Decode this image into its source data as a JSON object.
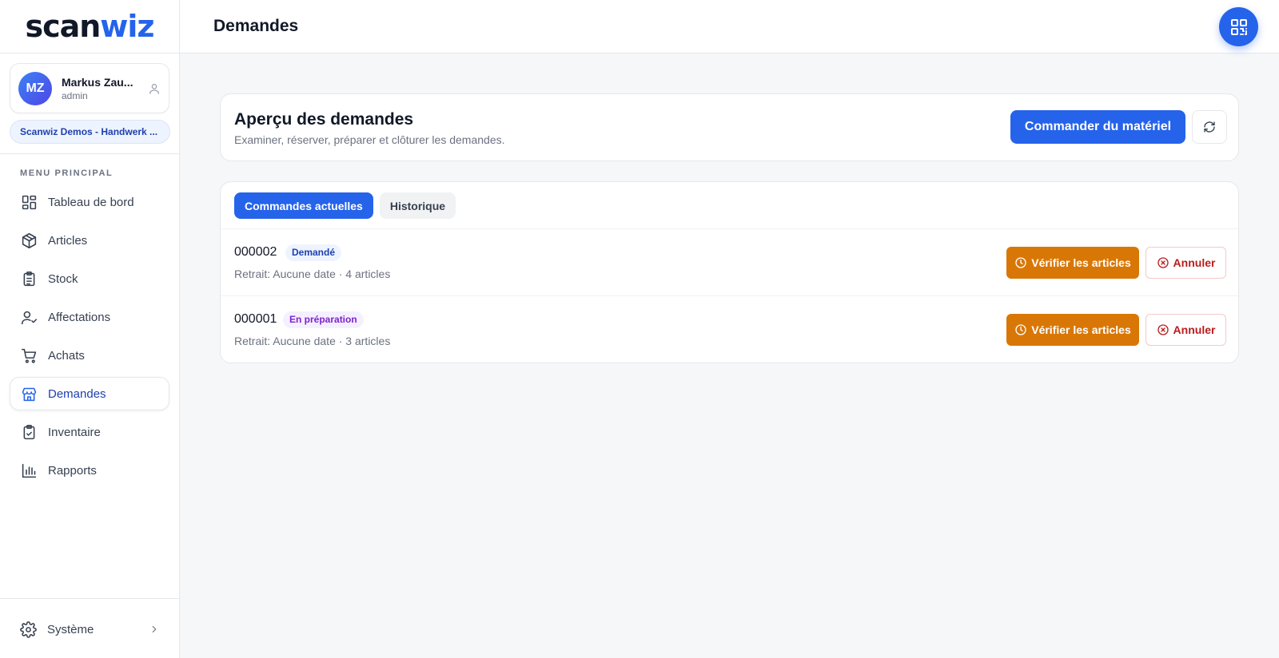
{
  "app": {
    "logo_part1": "scan",
    "logo_part2": "wiz",
    "accent_color": "#2563eb"
  },
  "user": {
    "initials": "MZ",
    "name": "Markus Zau...",
    "role": "admin",
    "company": "Scanwiz Demos - Handwerk ..."
  },
  "sidebar": {
    "heading": "MENU PRINCIPAL",
    "items": [
      {
        "label": "Tableau de bord",
        "icon": "dashboard-icon"
      },
      {
        "label": "Articles",
        "icon": "box-icon"
      },
      {
        "label": "Stock",
        "icon": "clipboard-list-icon"
      },
      {
        "label": "Affectations",
        "icon": "user-check-icon"
      },
      {
        "label": "Achats",
        "icon": "cart-icon"
      },
      {
        "label": "Demandes",
        "icon": "store-icon",
        "active": true
      },
      {
        "label": "Inventaire",
        "icon": "clipboard-check-icon"
      },
      {
        "label": "Rapports",
        "icon": "bar-chart-icon"
      }
    ],
    "system_label": "Système"
  },
  "header": {
    "title": "Demandes",
    "qr_icon": "qr-code-icon"
  },
  "overview": {
    "title": "Aperçu des demandes",
    "subtitle": "Examiner, réserver, préparer et clôturer les demandes.",
    "order_button": "Commander du matériel",
    "refresh_icon": "refresh-icon"
  },
  "tabs": [
    {
      "label": "Commandes actuelles",
      "active": true
    },
    {
      "label": "Historique",
      "active": false
    }
  ],
  "orders": [
    {
      "id": "000002",
      "status": "Demandé",
      "status_color": "#1e40af",
      "meta": "Retrait: Aucune date · 4 articles",
      "verify_label": "Vérifier les articles",
      "cancel_label": "Annuler"
    },
    {
      "id": "000001",
      "status": "En préparation",
      "status_color": "#7e22ce",
      "meta": "Retrait: Aucune date · 3 articles",
      "verify_label": "Vérifier les articles",
      "cancel_label": "Annuler"
    }
  ]
}
